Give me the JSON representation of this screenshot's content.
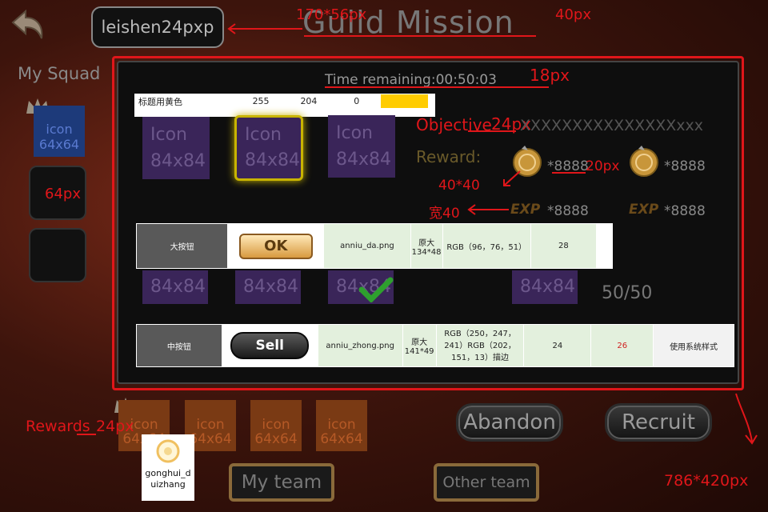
{
  "colors": {
    "annotation": "#e0161a",
    "accent": "#f5c400",
    "panel": "#0e0e0e"
  },
  "header": {
    "player_name": "leishen24pxp",
    "title": "Guild Mission",
    "name_box_note": "170*56px",
    "title_note": "40px"
  },
  "sidebar": {
    "title": "My Squad",
    "squad_icon_label": "icon\n64x64",
    "slot_note": "64px"
  },
  "panel": {
    "size_note": "786*420px",
    "time_remaining": "Time remaining:00:50:03",
    "time_note": "18px",
    "color_table": {
      "label": "标题用黄色",
      "r": "255",
      "g": "204",
      "b": "0",
      "swatch": "#ffcc00"
    },
    "icon_top": [
      {
        "line1": "Icon",
        "line2": "84x84"
      },
      {
        "line1": "Icon",
        "line2": "84x84"
      },
      {
        "line1": "Icon",
        "line2": "84x84"
      }
    ],
    "objective_label": "Objective",
    "objective_note": "24px",
    "objective_text": "XXXXXXXXXXXXXXXxxx",
    "reward_label": "Reward:",
    "reward_values": [
      "*8888",
      "*8888",
      "*8888",
      "*8888"
    ],
    "reward_size_note": "20px",
    "coin_note": "40*40",
    "exp_note": "宽40",
    "exp_label": "EXP",
    "spec_big": {
      "name": "大按钮",
      "btn": "OK",
      "file": "anniu_da.png",
      "size": "原大\n134*48",
      "color": "RGB（96，76，51）",
      "font": "28"
    },
    "icon_mid": [
      "84x84",
      "84x84",
      "84x84",
      "84x84"
    ],
    "progress": "50/50",
    "spec_mid": {
      "name": "中按钮",
      "btn": "Sell",
      "file": "anniu_zhong.png",
      "size": "原大\n141*49",
      "color": "RGB（250，247，241）RGB（202，151，13）描边",
      "font1": "24",
      "font2": "26",
      "note": "使用系统样式"
    }
  },
  "rewards": {
    "label": "Rewards",
    "note": "24px",
    "icons": [
      {
        "l1": "icon",
        "l2": "64x64"
      },
      {
        "l1": "icon",
        "l2": "64x64"
      },
      {
        "l1": "icon",
        "l2": "64x64"
      },
      {
        "l1": "icon",
        "l2": "64x64"
      }
    ],
    "file_label": "gonghui_d\nuizhang"
  },
  "buttons": {
    "abandon": "Abandon",
    "recruit": "Recruit",
    "my_team": "My team",
    "other_team": "Other team"
  }
}
